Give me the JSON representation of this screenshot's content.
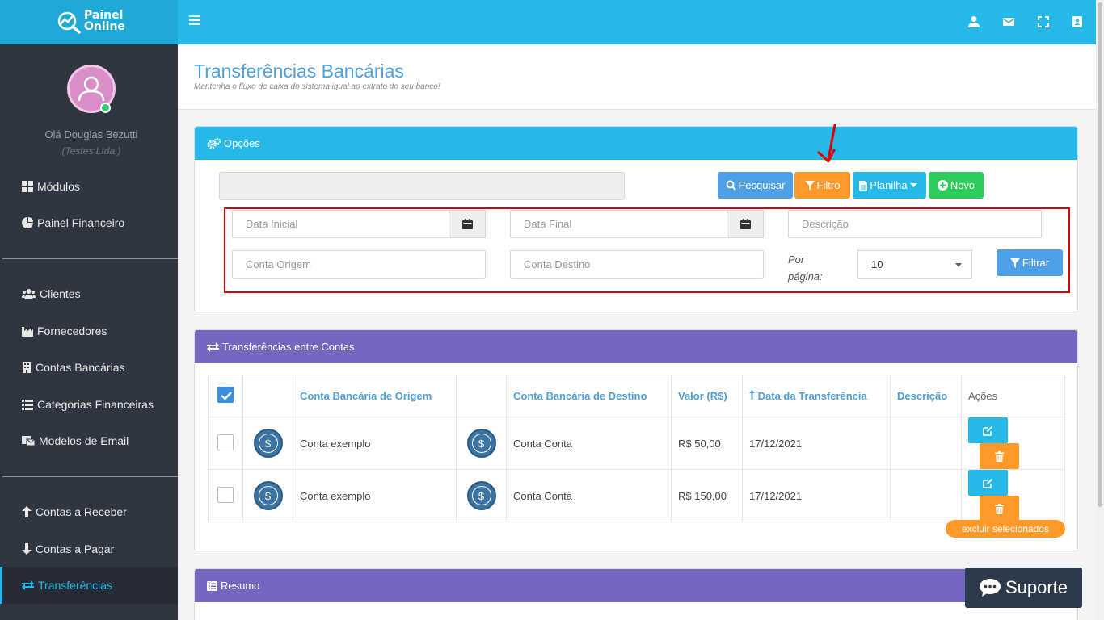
{
  "brand": {
    "line1": "Painel",
    "line2": "Online"
  },
  "user": {
    "greeting": "Olá Douglas Bezutti",
    "company": "(Testes Ltda.)"
  },
  "sidebar": {
    "items": [
      {
        "label": "Módulos",
        "icon": "grid-icon"
      },
      {
        "label": "Painel Financeiro",
        "icon": "pie-chart-icon"
      },
      {
        "label": "Clientes",
        "icon": "users-icon"
      },
      {
        "label": "Fornecedores",
        "icon": "industry-icon"
      },
      {
        "label": "Contas Bancárias",
        "icon": "building-icon"
      },
      {
        "label": "Categorias Financeiras",
        "icon": "list-icon"
      },
      {
        "label": "Modelos de Email",
        "icon": "email-template-icon"
      },
      {
        "label": "Contas a Receber",
        "icon": "arrow-up-icon"
      },
      {
        "label": "Contas a Pagar",
        "icon": "arrow-down-icon"
      },
      {
        "label": "Transferências",
        "icon": "exchange-icon",
        "active": true
      }
    ]
  },
  "page": {
    "title": "Transferências Bancárias",
    "subtitle": "Mantenha o fluxo de caixa do sistema igual ao extrato do seu banco!"
  },
  "options": {
    "heading": "Opções",
    "search_value": "",
    "buttons": {
      "search": "Pesquisar",
      "filter": "Filtro",
      "sheet": "Planilha",
      "new": "Novo"
    },
    "filters": {
      "start_date": "Data Inicial",
      "end_date": "Data Final",
      "description": "Descrição",
      "origin": "Conta Origem",
      "destination": "Conta Destino",
      "per_page_label": "Por página:",
      "per_page_value": "10",
      "apply": "Filtrar"
    }
  },
  "transfers": {
    "heading": "Transferências entre Contas",
    "columns": {
      "origin": "Conta Bancária de Origem",
      "destination": "Conta Bancária de Destino",
      "value": "Valor (R$)",
      "date": "Data da Transferência",
      "description": "Descrição",
      "actions": "Ações"
    },
    "rows": [
      {
        "origin": "Conta exemplo",
        "destination": "Conta Conta",
        "value": "R$ 50,00",
        "date": "17/12/2021",
        "description": ""
      },
      {
        "origin": "Conta exemplo",
        "destination": "Conta Conta",
        "value": "R$ 150,00",
        "date": "17/12/2021",
        "description": ""
      }
    ],
    "bulk_delete": "excluir selecionados"
  },
  "summary": {
    "heading": "Resumo"
  },
  "support": {
    "label": "Suporte"
  },
  "colors": {
    "topbar": "#26b8e6",
    "sidebar": "#2f3541",
    "purple_panel": "#7467c0",
    "orange": "#ff9a2a",
    "green": "#2ecc5a",
    "blue_btn": "#4e9fe5"
  }
}
